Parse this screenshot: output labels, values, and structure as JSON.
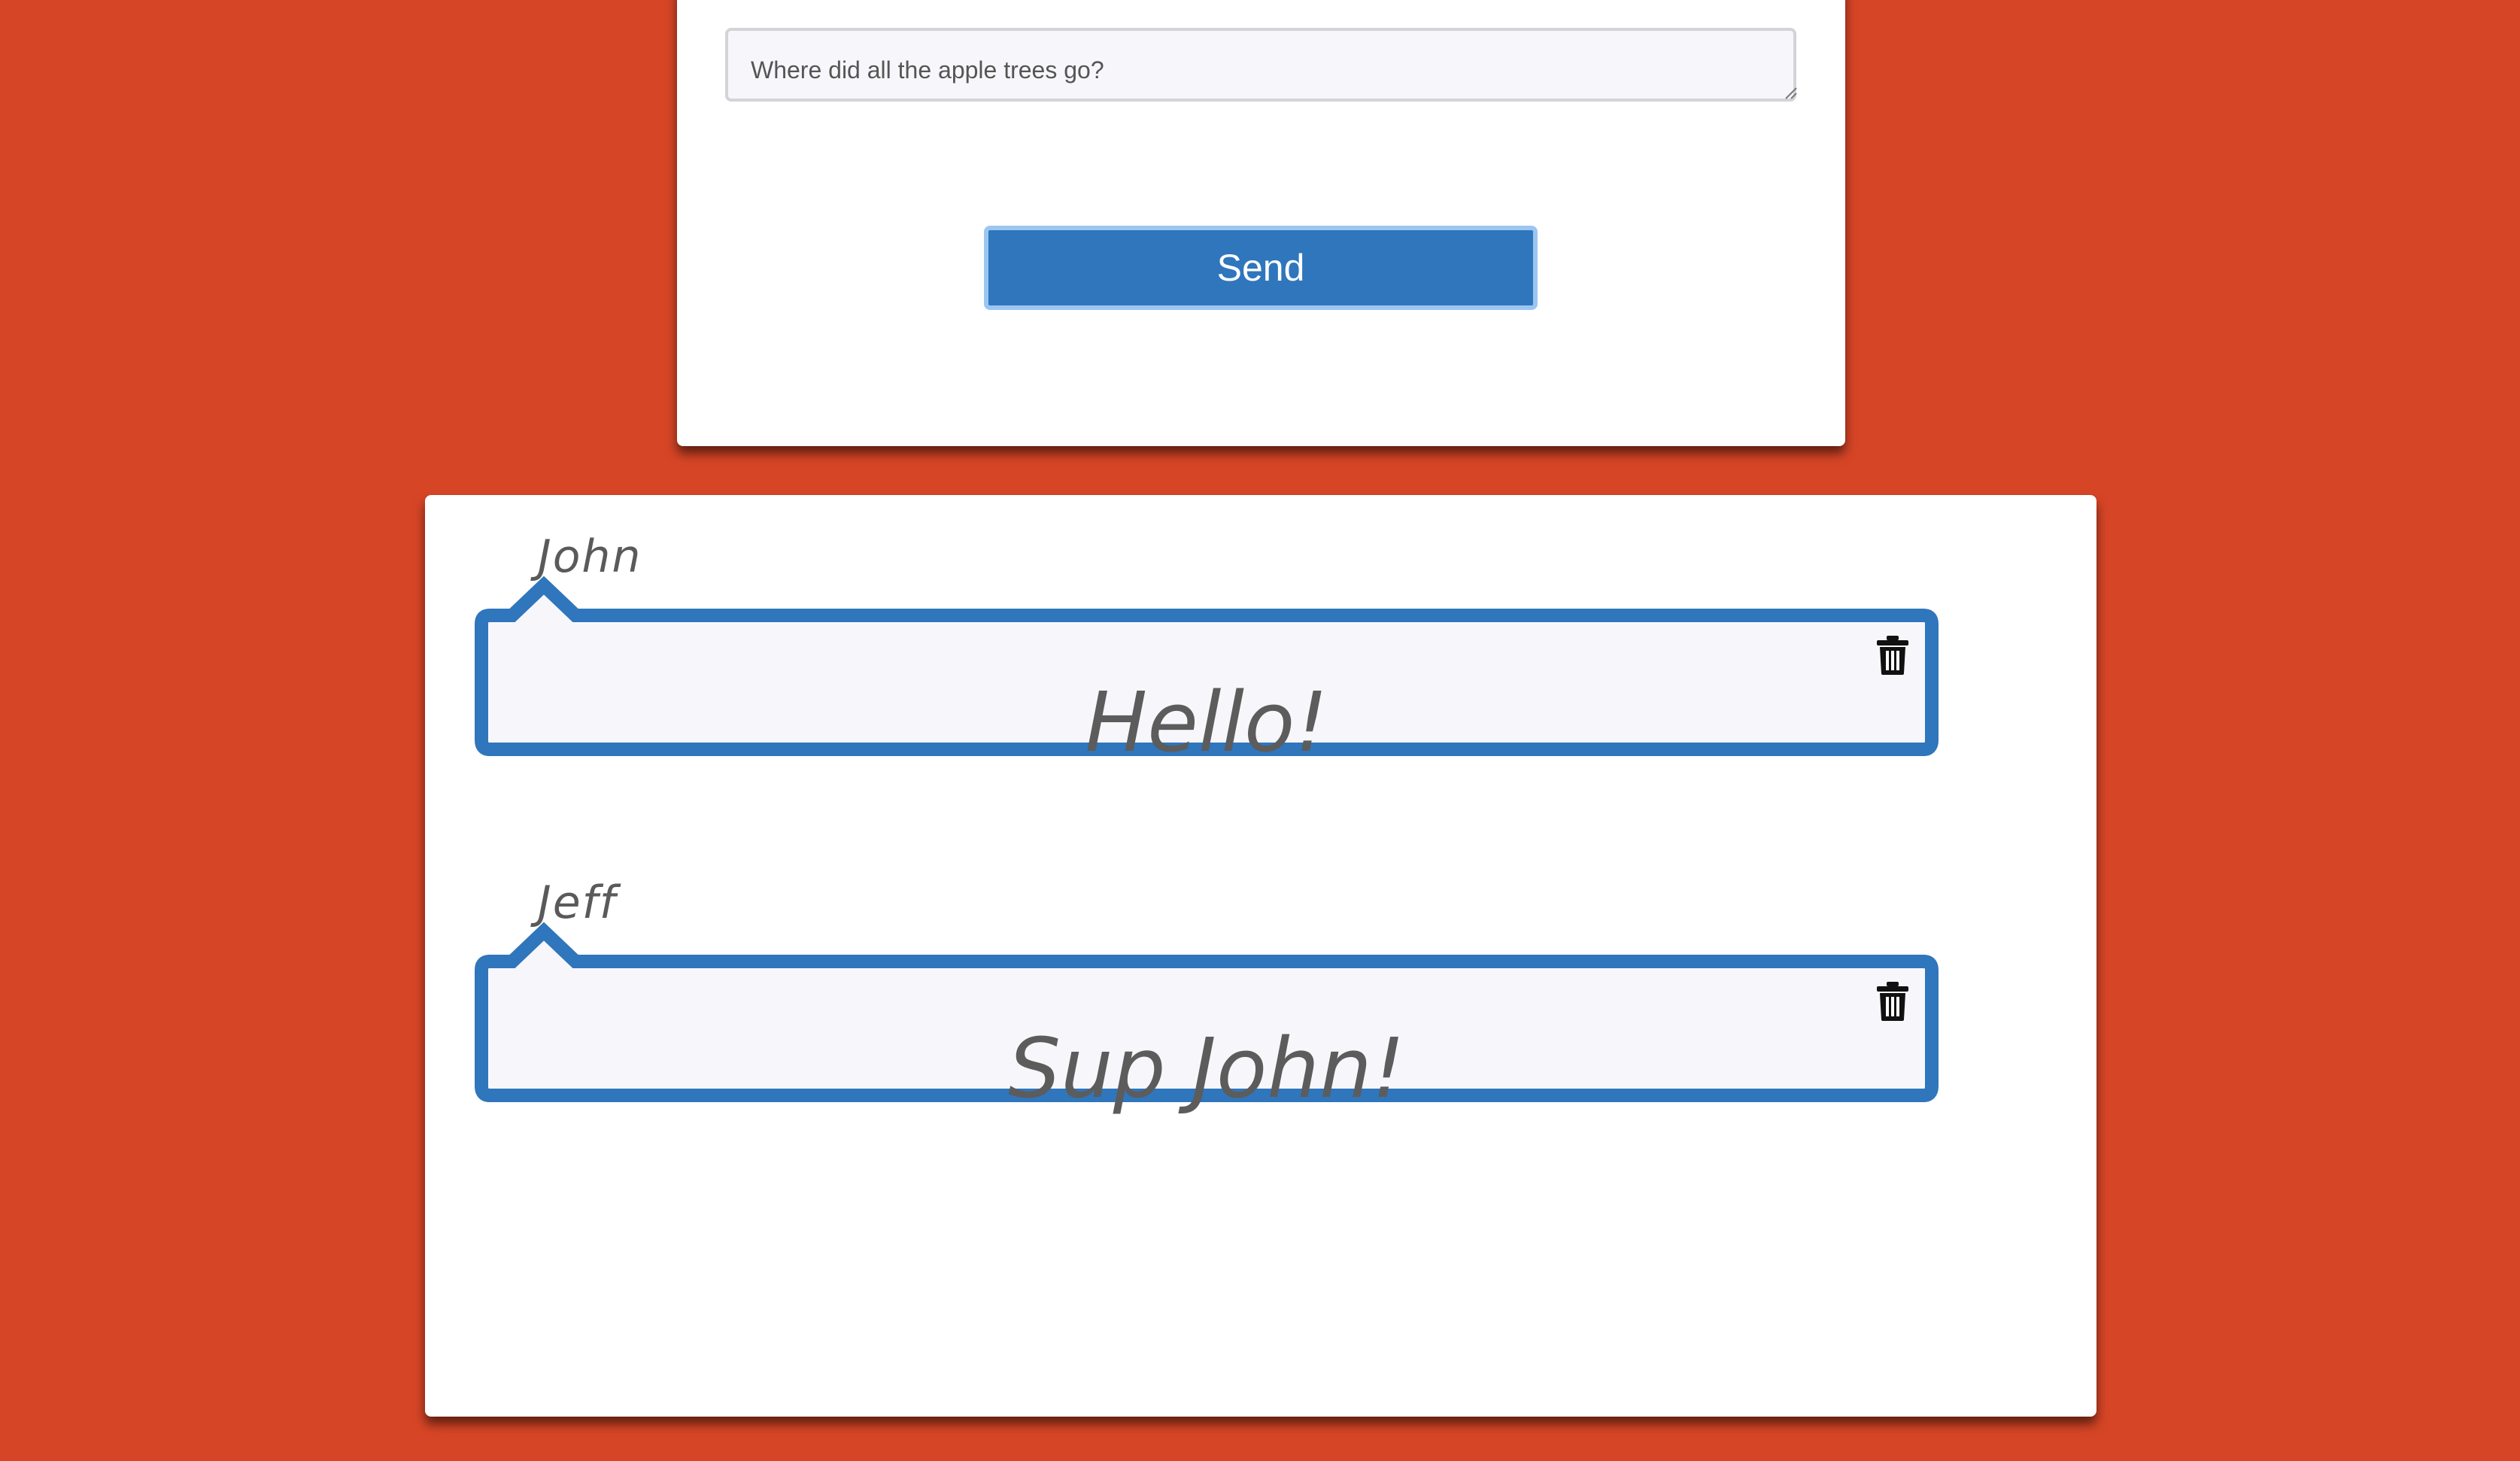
{
  "composer": {
    "message_placeholder": "Where did all the apple trees go?",
    "send_label": "Send"
  },
  "messages": [
    {
      "author": "John",
      "text": "Hello!",
      "delete_icon": "trash-icon"
    },
    {
      "author": "Jeff",
      "text": "Sup John!",
      "delete_icon": "trash-icon"
    }
  ],
  "colors": {
    "page_background": "#d64526",
    "accent": "#2f76bc",
    "bubble_background": "#f7f7fb"
  }
}
